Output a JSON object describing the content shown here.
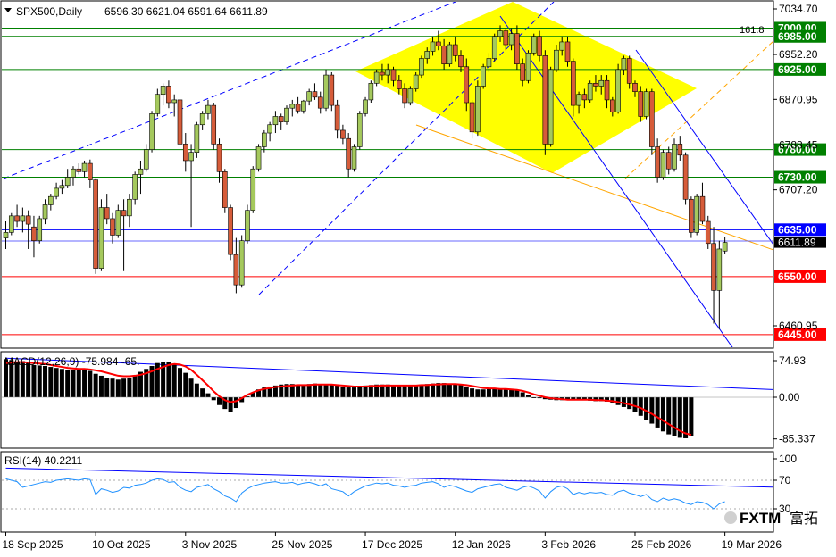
{
  "header": {
    "symbol": "SPX500,Daily",
    "ohlc": "6596.30 6621.04 6591.64 6611.89"
  },
  "watermark": {
    "brand": "FXTM",
    "cn": "富拓"
  },
  "colors": {
    "bull": "#a5c95d",
    "bear": "#d65c3a",
    "zone": "#ffff00",
    "green_line": "#008000",
    "blue_line": "#0000ff",
    "red_line": "#ff0000",
    "macd_signal": "#ff0000",
    "rsi_line": "#1e90ff",
    "fib_line": "#ffa500"
  },
  "chart_data": [
    {
      "type": "candlestick",
      "title": "SPX500,Daily",
      "ylim": [
        6400,
        7050
      ],
      "y_ticks": [
        {
          "value": 7034.7,
          "label": "7034.70"
        },
        {
          "value": 6952.2,
          "label": "6952.20"
        },
        {
          "value": 6870.95,
          "label": "6870.95"
        },
        {
          "value": 6788.45,
          "label": "6788.45"
        },
        {
          "value": 6707.2,
          "label": "6707.20"
        },
        {
          "value": 6460.95,
          "label": "6460.95"
        }
      ],
      "x_labels": [
        {
          "i": 0,
          "label": "18 Sep 2025"
        },
        {
          "i": 16,
          "label": "10 Oct 2025"
        },
        {
          "i": 32,
          "label": "3 Nov 2025"
        },
        {
          "i": 48,
          "label": "25 Nov 2025"
        },
        {
          "i": 64,
          "label": "17 Dec 2025"
        },
        {
          "i": 80,
          "label": "12 Jan 2026"
        },
        {
          "i": 96,
          "label": "3 Feb 2026"
        },
        {
          "i": 112,
          "label": "25 Feb 2026"
        },
        {
          "i": 128,
          "label": "19 Mar 2026"
        }
      ],
      "levels": [
        {
          "value": 7000,
          "label": "7000.00",
          "kind": "green"
        },
        {
          "value": 6985,
          "label": "6985.00",
          "kind": "green"
        },
        {
          "value": 6925,
          "label": "6925.00",
          "kind": "green"
        },
        {
          "value": 6780,
          "label": "6780.00",
          "kind": "green"
        },
        {
          "value": 6730,
          "label": "6730.00",
          "kind": "green"
        },
        {
          "value": 6635,
          "label": "6635.00",
          "kind": "blue"
        },
        {
          "value": 6550,
          "label": "6550.00",
          "kind": "red"
        },
        {
          "value": 6445,
          "label": "6445.00",
          "kind": "red"
        }
      ],
      "fib_label": "161.8",
      "current_price": {
        "value": 6611.89,
        "label": "6611.89"
      },
      "candles": [
        [
          6620,
          6650,
          6600,
          6630
        ],
        [
          6630,
          6665,
          6625,
          6660
        ],
        [
          6660,
          6680,
          6640,
          6650
        ],
        [
          6650,
          6675,
          6630,
          6660
        ],
        [
          6660,
          6670,
          6600,
          6645
        ],
        [
          6640,
          6660,
          6585,
          6615
        ],
        [
          6615,
          6660,
          6610,
          6655
        ],
        [
          6655,
          6690,
          6645,
          6680
        ],
        [
          6680,
          6700,
          6670,
          6695
        ],
        [
          6695,
          6720,
          6690,
          6710
        ],
        [
          6710,
          6725,
          6700,
          6715
        ],
        [
          6715,
          6745,
          6710,
          6730
        ],
        [
          6730,
          6750,
          6715,
          6745
        ],
        [
          6745,
          6755,
          6735,
          6740
        ],
        [
          6740,
          6760,
          6730,
          6755
        ],
        [
          6755,
          6762,
          6710,
          6725
        ],
        [
          6725,
          6728,
          6555,
          6565
        ],
        [
          6565,
          6690,
          6560,
          6675
        ],
        [
          6675,
          6700,
          6645,
          6655
        ],
        [
          6655,
          6665,
          6610,
          6625
        ],
        [
          6625,
          6680,
          6620,
          6670
        ],
        [
          6670,
          6690,
          6560,
          6660
        ],
        [
          6660,
          6700,
          6640,
          6690
        ],
        [
          6690,
          6740,
          6680,
          6735
        ],
        [
          6735,
          6760,
          6700,
          6745
        ],
        [
          6745,
          6790,
          6740,
          6780
        ],
        [
          6780,
          6850,
          6775,
          6845
        ],
        [
          6845,
          6890,
          6840,
          6880
        ],
        [
          6880,
          6900,
          6860,
          6895
        ],
        [
          6895,
          6905,
          6855,
          6865
        ],
        [
          6865,
          6880,
          6840,
          6870
        ],
        [
          6870,
          6880,
          6770,
          6790
        ],
        [
          6790,
          6810,
          6740,
          6760
        ],
        [
          6760,
          6790,
          6640,
          6775
        ],
        [
          6775,
          6830,
          6765,
          6825
        ],
        [
          6825,
          6850,
          6815,
          6845
        ],
        [
          6845,
          6870,
          6835,
          6860
        ],
        [
          6860,
          6865,
          6780,
          6790
        ],
        [
          6790,
          6800,
          6720,
          6740
        ],
        [
          6740,
          6745,
          6665,
          6675
        ],
        [
          6675,
          6680,
          6580,
          6590
        ],
        [
          6590,
          6620,
          6520,
          6535
        ],
        [
          6535,
          6625,
          6530,
          6615
        ],
        [
          6615,
          6680,
          6610,
          6670
        ],
        [
          6670,
          6750,
          6665,
          6745
        ],
        [
          6745,
          6790,
          6740,
          6785
        ],
        [
          6785,
          6815,
          6775,
          6810
        ],
        [
          6810,
          6830,
          6795,
          6825
        ],
        [
          6825,
          6850,
          6810,
          6840
        ],
        [
          6840,
          6845,
          6815,
          6830
        ],
        [
          6830,
          6860,
          6825,
          6855
        ],
        [
          6855,
          6870,
          6840,
          6862
        ],
        [
          6862,
          6875,
          6845,
          6850
        ],
        [
          6850,
          6870,
          6845,
          6868
        ],
        [
          6868,
          6890,
          6860,
          6885
        ],
        [
          6885,
          6900,
          6870,
          6875
        ],
        [
          6875,
          6885,
          6845,
          6855
        ],
        [
          6855,
          6925,
          6850,
          6915
        ],
        [
          6915,
          6920,
          6850,
          6860
        ],
        [
          6860,
          6870,
          6800,
          6815
        ],
        [
          6815,
          6825,
          6790,
          6800
        ],
        [
          6800,
          6810,
          6730,
          6745
        ],
        [
          6745,
          6790,
          6740,
          6785
        ],
        [
          6785,
          6850,
          6780,
          6845
        ],
        [
          6845,
          6875,
          6840,
          6870
        ],
        [
          6870,
          6905,
          6865,
          6900
        ],
        [
          6900,
          6925,
          6895,
          6920
        ],
        [
          6920,
          6935,
          6905,
          6915
        ],
        [
          6915,
          6935,
          6900,
          6925
        ],
        [
          6925,
          6930,
          6895,
          6905
        ],
        [
          6905,
          6915,
          6880,
          6890
        ],
        [
          6890,
          6900,
          6855,
          6865
        ],
        [
          6865,
          6895,
          6860,
          6890
        ],
        [
          6890,
          6920,
          6885,
          6915
        ],
        [
          6915,
          6950,
          6910,
          6945
        ],
        [
          6945,
          6965,
          6935,
          6958
        ],
        [
          6958,
          6985,
          6950,
          6975
        ],
        [
          6975,
          6995,
          6960,
          6968
        ],
        [
          6968,
          6980,
          6925,
          6935
        ],
        [
          6935,
          6975,
          6930,
          6970
        ],
        [
          6970,
          6985,
          6940,
          6950
        ],
        [
          6950,
          6960,
          6920,
          6930
        ],
        [
          6930,
          6945,
          6850,
          6865
        ],
        [
          6865,
          6870,
          6800,
          6812
        ],
        [
          6812,
          6905,
          6805,
          6895
        ],
        [
          6895,
          6935,
          6890,
          6930
        ],
        [
          6930,
          6955,
          6920,
          6945
        ],
        [
          6945,
          6990,
          6940,
          6985
        ],
        [
          6985,
          7005,
          6975,
          6995
        ],
        [
          6995,
          7000,
          6960,
          6970
        ],
        [
          6970,
          7000,
          6960,
          6990
        ],
        [
          6990,
          7005,
          6925,
          6935
        ],
        [
          6935,
          6945,
          6895,
          6905
        ],
        [
          6905,
          6960,
          6900,
          6955
        ],
        [
          6955,
          6990,
          6950,
          6985
        ],
        [
          6985,
          6995,
          6940,
          6950
        ],
        [
          6950,
          6960,
          6770,
          6790
        ],
        [
          6790,
          6930,
          6785,
          6925
        ],
        [
          6925,
          6970,
          6920,
          6960
        ],
        [
          6960,
          6985,
          6950,
          6975
        ],
        [
          6975,
          6985,
          6930,
          6940
        ],
        [
          6940,
          6945,
          6840,
          6860
        ],
        [
          6860,
          6885,
          6845,
          6880
        ],
        [
          6880,
          6890,
          6855,
          6870
        ],
        [
          6870,
          6905,
          6865,
          6900
        ],
        [
          6900,
          6915,
          6885,
          6895
        ],
        [
          6895,
          6915,
          6880,
          6905
        ],
        [
          6905,
          6915,
          6855,
          6870
        ],
        [
          6870,
          6875,
          6840,
          6848
        ],
        [
          6848,
          6935,
          6845,
          6925
        ],
        [
          6925,
          6950,
          6915,
          6945
        ],
        [
          6945,
          6950,
          6890,
          6900
        ],
        [
          6900,
          6905,
          6875,
          6885
        ],
        [
          6885,
          6895,
          6830,
          6840
        ],
        [
          6840,
          6890,
          6835,
          6885
        ],
        [
          6885,
          6890,
          6770,
          6785
        ],
        [
          6785,
          6800,
          6720,
          6730
        ],
        [
          6730,
          6780,
          6725,
          6775
        ],
        [
          6775,
          6785,
          6735,
          6745
        ],
        [
          6745,
          6800,
          6740,
          6790
        ],
        [
          6790,
          6805,
          6760,
          6770
        ],
        [
          6770,
          6775,
          6680,
          6690
        ],
        [
          6690,
          6695,
          6620,
          6630
        ],
        [
          6630,
          6700,
          6625,
          6695
        ],
        [
          6695,
          6720,
          6645,
          6650
        ],
        [
          6650,
          6660,
          6600,
          6610
        ],
        [
          6610,
          6640,
          6465,
          6525
        ],
        [
          6525,
          6615,
          6455,
          6600
        ],
        [
          6596.3,
          6621.04,
          6591.64,
          6611.89
        ]
      ]
    },
    {
      "type": "bar",
      "title": "MACD(12,26,9) -75.984 -65.313",
      "label_visible": "MACD(12,26,9) -75.984 -65.",
      "ylim": [
        -100,
        95
      ],
      "y_ticks": [
        {
          "value": 74.93,
          "label": "74.93"
        },
        {
          "value": 0,
          "label": "0.00"
        },
        {
          "value": -85.337,
          "label": "-85.337"
        }
      ],
      "histogram": [
        78,
        76,
        72,
        74,
        70,
        66,
        65,
        64,
        62,
        60,
        58,
        56,
        55,
        55,
        56,
        54,
        48,
        44,
        40,
        38,
        36,
        38,
        40,
        45,
        52,
        58,
        64,
        70,
        72,
        72,
        68,
        60,
        50,
        38,
        28,
        18,
        8,
        -6,
        -16,
        -24,
        -30,
        -22,
        -10,
        2,
        10,
        16,
        20,
        22,
        24,
        26,
        27,
        27,
        26,
        26,
        27,
        28,
        27,
        26,
        26,
        24,
        22,
        20,
        20,
        22,
        24,
        25,
        26,
        26,
        26,
        25,
        25,
        24,
        24,
        25,
        26,
        27,
        28,
        29,
        29,
        28,
        27,
        25,
        22,
        18,
        16,
        16,
        17,
        18,
        18,
        17,
        16,
        14,
        10,
        4,
        0,
        -2,
        -4,
        -5,
        -6,
        -6,
        -6,
        -5,
        -5,
        -6,
        -7,
        -8,
        -8,
        -9,
        -12,
        -16,
        -20,
        -24,
        -30,
        -38,
        -46,
        -54,
        -62,
        -70,
        -76,
        -80,
        -83,
        -84,
        -80
      ],
      "signal": [
        70,
        71,
        72,
        72,
        71,
        70,
        69,
        68,
        66,
        64,
        62,
        60,
        59,
        58,
        58,
        57,
        55,
        53,
        50,
        47,
        44,
        43,
        43,
        44,
        46,
        49,
        53,
        58,
        62,
        66,
        68,
        67,
        63,
        56,
        46,
        35,
        24,
        12,
        2,
        -6,
        -10,
        -8,
        -2,
        5,
        10,
        14,
        17,
        19,
        21,
        22,
        23,
        24,
        25,
        25,
        25,
        26,
        26,
        26,
        26,
        25,
        24,
        23,
        22,
        22,
        22,
        23,
        23,
        24,
        24,
        24,
        24,
        24,
        24,
        24,
        25,
        25,
        26,
        26,
        27,
        27,
        27,
        26,
        25,
        23,
        21,
        19,
        18,
        18,
        17,
        17,
        16,
        15,
        13,
        10,
        6,
        3,
        0,
        -2,
        -3,
        -4,
        -5,
        -5,
        -5,
        -5,
        -5,
        -6,
        -6,
        -7,
        -8,
        -10,
        -12,
        -15,
        -18,
        -22,
        -28,
        -34,
        -41,
        -48,
        -55,
        -62,
        -69,
        -74,
        -77
      ],
      "trend_line_from": [
        0,
        80
      ],
      "trend_line_to": [
        138,
        15
      ]
    },
    {
      "type": "line",
      "title": "RSI(14) 40.2211",
      "ylim": [
        0,
        100
      ],
      "y_ticks": [
        {
          "value": 100,
          "label": "100"
        },
        {
          "value": 70,
          "label": "70"
        },
        {
          "value": 30,
          "label": "30"
        }
      ],
      "values": [
        72,
        70,
        68,
        60,
        62,
        64,
        66,
        68,
        67,
        70,
        71,
        72,
        71,
        70,
        72,
        71,
        50,
        58,
        56,
        53,
        55,
        60,
        59,
        63,
        64,
        66,
        70,
        72,
        71,
        67,
        68,
        60,
        56,
        54,
        60,
        62,
        64,
        58,
        54,
        48,
        45,
        40,
        52,
        58,
        62,
        64,
        66,
        67,
        68,
        66,
        66,
        67,
        64,
        66,
        67,
        65,
        62,
        65,
        58,
        56,
        54,
        48,
        54,
        58,
        62,
        64,
        66,
        65,
        66,
        63,
        62,
        60,
        62,
        63,
        66,
        67,
        68,
        65,
        60,
        63,
        61,
        58,
        55,
        53,
        58,
        60,
        62,
        64,
        65,
        60,
        58,
        56,
        60,
        62,
        59,
        55,
        45,
        54,
        60,
        62,
        58,
        50,
        53,
        51,
        53,
        52,
        53,
        50,
        49,
        54,
        56,
        52,
        50,
        47,
        50,
        43,
        40,
        45,
        42,
        44,
        42,
        38,
        36,
        40,
        39,
        36,
        30,
        37,
        40
      ],
      "trend_line_from": [
        0,
        87
      ],
      "trend_line_to": [
        138,
        60
      ]
    }
  ]
}
